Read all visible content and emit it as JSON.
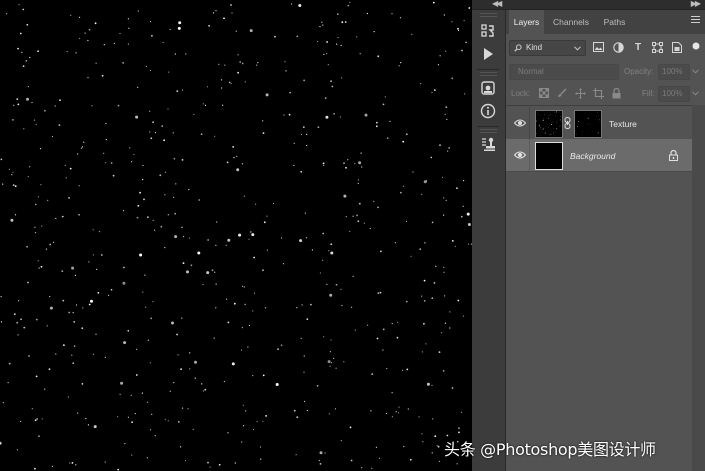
{
  "layers_panel": {
    "tabs": [
      {
        "label": "Layers",
        "active": true
      },
      {
        "label": "Channels",
        "active": false
      },
      {
        "label": "Paths",
        "active": false
      }
    ],
    "filter": {
      "kind_label": "Kind"
    },
    "blend_mode": "Normal",
    "opacity_label": "Opacity:",
    "opacity_value": "100%",
    "lock_label": "Lock:",
    "fill_label": "Fill:",
    "fill_value": "100%",
    "layers": [
      {
        "name": "Texture",
        "visible": true,
        "selected": false,
        "has_mask": true
      },
      {
        "name": "Background",
        "visible": true,
        "selected": true,
        "locked": true
      }
    ]
  },
  "watermark": "头条 @Photoshop美图设计师",
  "colors": {
    "panel_bg": "#535353",
    "tab_bar": "#424242",
    "selected_row": "#6b6b6b",
    "canvas": "#000000"
  }
}
